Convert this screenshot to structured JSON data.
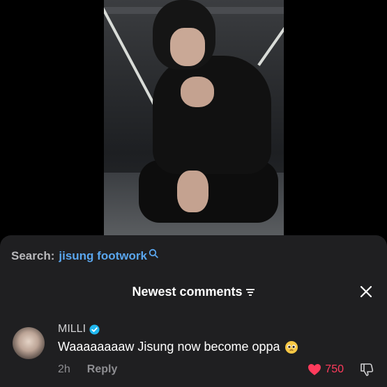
{
  "search": {
    "prefix": "Search:",
    "term": "jisung footwork"
  },
  "comments": {
    "header": "Newest comments",
    "items": [
      {
        "username": "MILLI",
        "verified": true,
        "text": "Waaaaaaaaw Jisung now become oppa",
        "emoji": "pleading-face",
        "time": "2h",
        "reply_label": "Reply",
        "likes": "750",
        "liked": true
      }
    ]
  },
  "colors": {
    "sheet_bg": "#1f1f21",
    "link": "#5aa6ee",
    "like": "#ff3b5c",
    "verified": "#20b8f0"
  }
}
